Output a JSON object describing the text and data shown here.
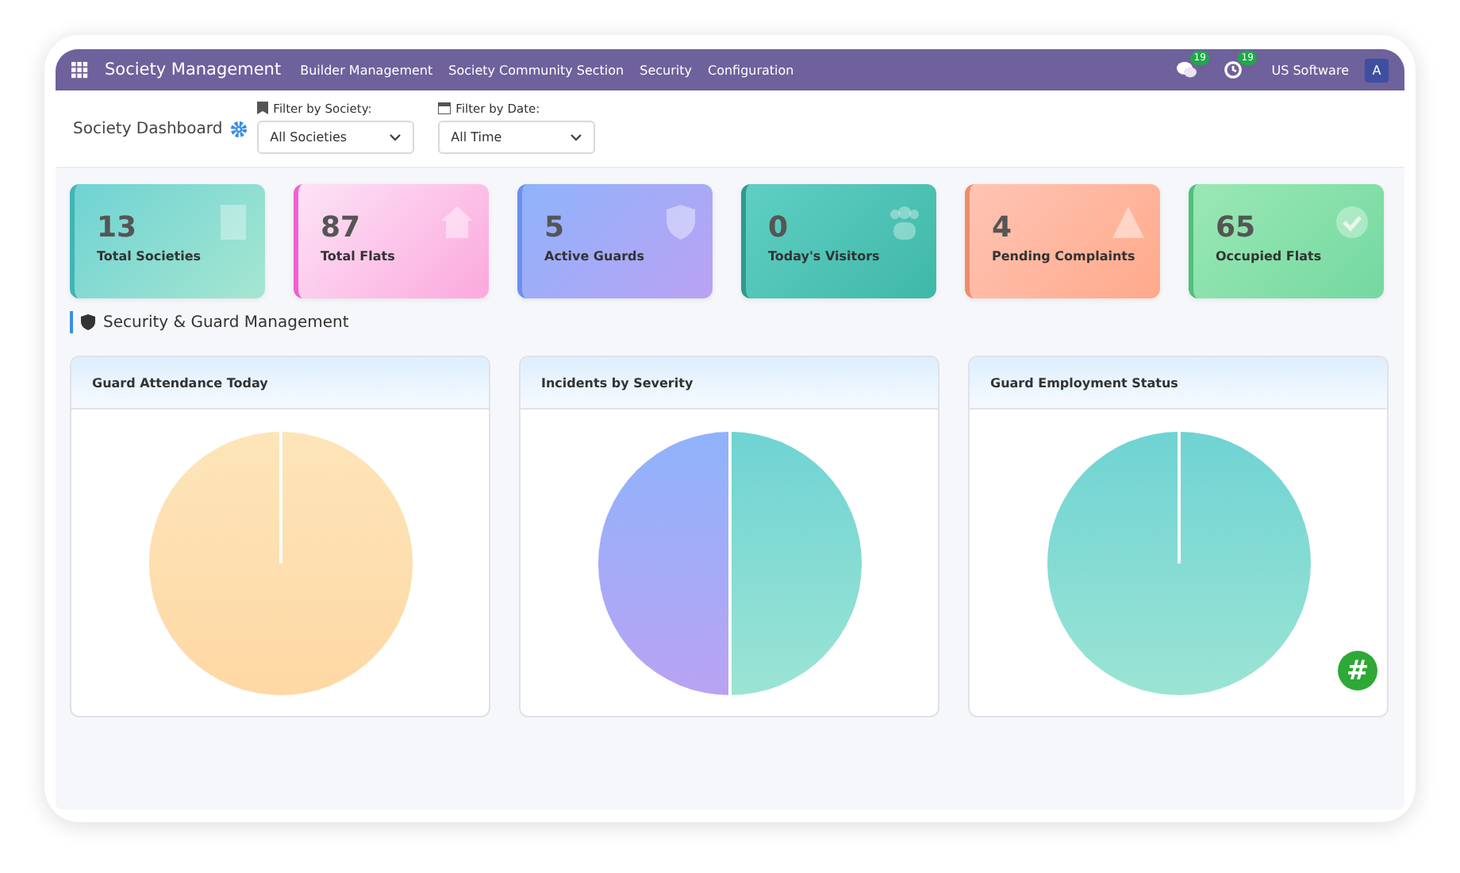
{
  "navbar": {
    "brand": "Society Management",
    "menu": [
      "Builder Management",
      "Society Community Section",
      "Security",
      "Configuration"
    ],
    "chat_badge": "19",
    "activity_badge": "19",
    "company": "US Software",
    "avatar": "A"
  },
  "header": {
    "title": "Society Dashboard",
    "filters": [
      {
        "label": "Filter by Society:",
        "kind": "society",
        "value": "All Societies"
      },
      {
        "label": "Filter by Date:",
        "kind": "date",
        "value": "All Time"
      }
    ]
  },
  "stats": [
    {
      "value": "13",
      "label": "Total Societies",
      "kind": "building"
    },
    {
      "value": "87",
      "label": "Total Flats",
      "kind": "home"
    },
    {
      "value": "5",
      "label": "Active Guards",
      "kind": "shield"
    },
    {
      "value": "0",
      "label": "Today's Visitors",
      "kind": "users"
    },
    {
      "value": "4",
      "label": "Pending Complaints",
      "kind": "warning"
    },
    {
      "value": "65",
      "label": "Occupied Flats",
      "kind": "check"
    }
  ],
  "section": {
    "title": "Security & Guard Management"
  },
  "charts": [
    {
      "title": "Guard Attendance Today",
      "kind": "full-peach"
    },
    {
      "title": "Incidents by Severity",
      "kind": "half"
    },
    {
      "title": "Guard Employment Status",
      "kind": "full-teal"
    }
  ],
  "fab": "#"
}
